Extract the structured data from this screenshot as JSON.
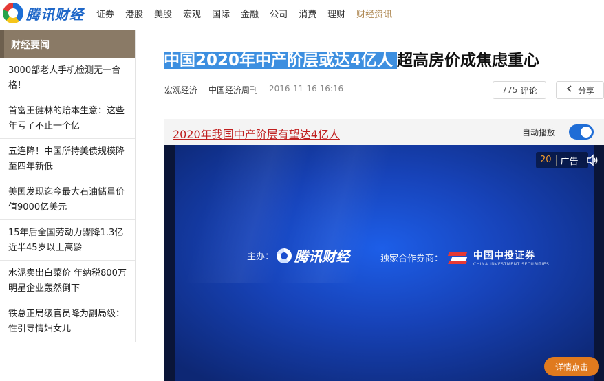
{
  "brand": {
    "name": "腾讯财经"
  },
  "nav": {
    "items": [
      "证券",
      "港股",
      "美股",
      "宏观",
      "国际",
      "金融",
      "公司",
      "消费",
      "理财",
      "财经资讯"
    ],
    "active_index": 9
  },
  "sidebar": {
    "title": "财经要闻",
    "items": [
      "3000部老人手机检测无一合格！",
      "首富王健林的赔本生意：这些年亏了不止一个亿",
      "五连降！中国所持美债规模降至四年新低",
      "美国发现迄今最大石油储量价值9000亿美元",
      "15年后全国劳动力骤降1.3亿 近半45岁以上高龄",
      "水泥卖出白菜价 年纳税800万明星企业轰然倒下",
      "铁总正局级官员降为副局级：性引导情妇女儿"
    ]
  },
  "article": {
    "title_highlighted": "中国2020年中产阶层或达4亿人",
    "title_rest": "超高房价成焦虑重心",
    "category": "宏观经济",
    "source": "中国经济周刊",
    "time": "2016-11-16 16:16",
    "comment_count": "775",
    "comment_label": "评论",
    "share_label": "分享"
  },
  "video": {
    "link_text": "2020年我国中产阶层有望达4亿人",
    "autoplay_label": "自动播放",
    "autoplay_on": true,
    "ad_countdown": "20",
    "ad_label": "广告",
    "sponsor_prefix": "主办：",
    "sponsor_brand": "腾讯财经",
    "partner_prefix": "独家合作券商：",
    "partner_name_cn": "中国中投证券",
    "partner_name_en": "CHINA INVESTMENT SECURITIES",
    "detail_button": "详情点击"
  },
  "colors": {
    "accent_blue": "#1f67c8",
    "sidebar_header": "#8a7a66",
    "link_red": "#c01f1f",
    "detail_orange": "#e07a1e",
    "ad_count_orange": "#f29a2e"
  }
}
